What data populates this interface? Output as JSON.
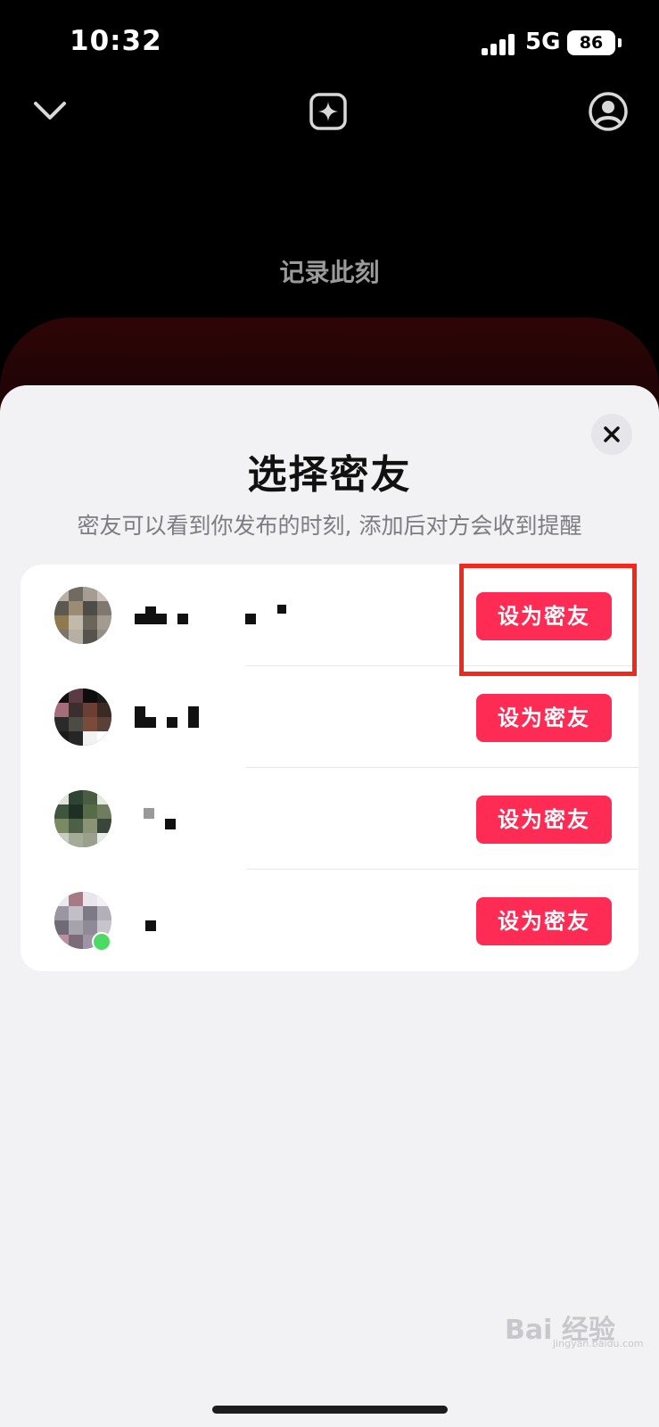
{
  "status_bar": {
    "time": "10:32",
    "network": "5G",
    "battery": "86"
  },
  "nav": {
    "icons": [
      "chevron-down-icon",
      "sparkle-icon",
      "profile-icon"
    ]
  },
  "record_title": "记录此刻",
  "sheet": {
    "title": "选择密友",
    "subtitle": "密友可以看到你发布的时刻, 添加后对方会收到提醒",
    "friends": [
      {
        "name": "",
        "button": "设为密友",
        "online": false
      },
      {
        "name": "",
        "button": "设为密友",
        "online": false
      },
      {
        "name": "",
        "button": "设为密友",
        "online": false
      },
      {
        "name": "",
        "button": "设为密友",
        "online": true
      }
    ]
  },
  "watermark": {
    "main": "Bai 经验",
    "sub": "jingyan.baidu.com"
  },
  "colors": {
    "accent": "#fe2c55",
    "highlight": "#f0291c",
    "sheet_bg": "#f2f2f5"
  }
}
